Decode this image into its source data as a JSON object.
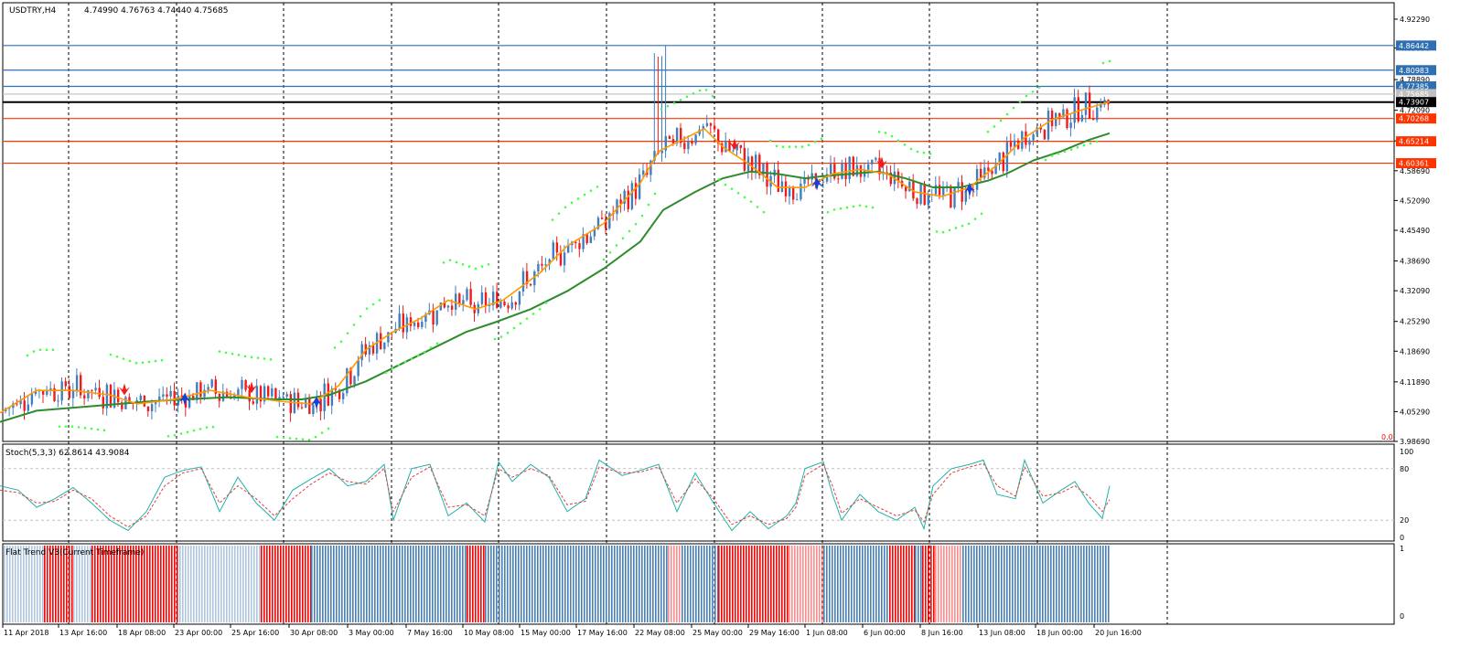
{
  "chart_data": [
    {
      "type": "candlestick",
      "title": "USDTRY,H4",
      "ohlc": [
        "4.74990",
        "4.76763",
        "4.74440",
        "4.75685"
      ],
      "y_range": [
        3.9869,
        4.9532
      ],
      "y_ticks": [
        "4.92290",
        "4.85890",
        "4.78890",
        "4.72090",
        "4.65290",
        "4.58690",
        "4.52090",
        "4.45490",
        "4.38690",
        "4.32090",
        "4.25290",
        "4.18690",
        "4.11890",
        "4.05290",
        "3.98690"
      ],
      "price_levels": [
        {
          "value": 4.86442,
          "label": "4.86442",
          "color": "#2f6fb3"
        },
        {
          "value": 4.80983,
          "label": "4.80983",
          "color": "#2f6fb3"
        },
        {
          "value": 4.77385,
          "label": "4.77385",
          "color": "#2f6fb3"
        },
        {
          "value": 4.75685,
          "label": "4.75685",
          "color": "#c0c0c0"
        },
        {
          "value": 4.73907,
          "label": "4.73907",
          "color": "#000000"
        },
        {
          "value": 4.70268,
          "label": "4.70268",
          "color": "#ff3300"
        },
        {
          "value": 4.65214,
          "label": "4.65214",
          "color": "#ff3300"
        },
        {
          "value": 4.60361,
          "label": "4.60361",
          "color": "#ff3300"
        }
      ],
      "moving_averages": [
        {
          "color": "#2e8b2e",
          "points": [
            [
              0,
              4.03
            ],
            [
              40,
              4.055
            ],
            [
              100,
              4.065
            ],
            [
              160,
              4.075
            ],
            [
              200,
              4.08
            ],
            [
              250,
              4.085
            ],
            [
              300,
              4.08
            ],
            [
              330,
              4.08
            ],
            [
              360,
              4.09
            ],
            [
              400,
              4.12
            ],
            [
              440,
              4.16
            ],
            [
              480,
              4.2
            ],
            [
              510,
              4.23
            ],
            [
              540,
              4.25
            ],
            [
              580,
              4.28
            ],
            [
              620,
              4.32
            ],
            [
              660,
              4.37
            ],
            [
              700,
              4.43
            ],
            [
              725,
              4.5
            ],
            [
              760,
              4.54
            ],
            [
              790,
              4.57
            ],
            [
              820,
              4.585
            ],
            [
              850,
              4.58
            ],
            [
              880,
              4.57
            ],
            [
              900,
              4.575
            ],
            [
              930,
              4.58
            ],
            [
              960,
              4.585
            ],
            [
              990,
              4.57
            ],
            [
              1020,
              4.55
            ],
            [
              1050,
              4.55
            ],
            [
              1080,
              4.565
            ],
            [
              1100,
              4.58
            ],
            [
              1130,
              4.61
            ],
            [
              1160,
              4.63
            ],
            [
              1190,
              4.655
            ],
            [
              1213,
              4.67
            ]
          ]
        },
        {
          "color": "#ff9900",
          "points": [
            [
              0,
              4.05
            ],
            [
              40,
              4.1
            ],
            [
              80,
              4.1
            ],
            [
              120,
              4.09
            ],
            [
              150,
              4.07
            ],
            [
              190,
              4.08
            ],
            [
              230,
              4.1
            ],
            [
              270,
              4.085
            ],
            [
              310,
              4.075
            ],
            [
              340,
              4.07
            ],
            [
              370,
              4.11
            ],
            [
              400,
              4.19
            ],
            [
              430,
              4.23
            ],
            [
              460,
              4.26
            ],
            [
              490,
              4.3
            ],
            [
              520,
              4.28
            ],
            [
              550,
              4.3
            ],
            [
              590,
              4.36
            ],
            [
              620,
              4.42
            ],
            [
              660,
              4.47
            ],
            [
              700,
              4.56
            ],
            [
              720,
              4.63
            ],
            [
              740,
              4.65
            ],
            [
              770,
              4.68
            ],
            [
              790,
              4.64
            ],
            [
              820,
              4.6
            ],
            [
              850,
              4.55
            ],
            [
              880,
              4.55
            ],
            [
              910,
              4.58
            ],
            [
              940,
              4.59
            ],
            [
              970,
              4.58
            ],
            [
              1000,
              4.54
            ],
            [
              1030,
              4.53
            ],
            [
              1060,
              4.55
            ],
            [
              1090,
              4.6
            ],
            [
              1120,
              4.66
            ],
            [
              1150,
              4.7
            ],
            [
              1180,
              4.72
            ],
            [
              1213,
              4.74
            ]
          ]
        }
      ],
      "signals": [
        {
          "dir": "down",
          "x": 136
        },
        {
          "dir": "up",
          "x": 202
        },
        {
          "dir": "down",
          "x": 275
        },
        {
          "dir": "up",
          "x": 346
        },
        {
          "dir": "down",
          "x": 803
        },
        {
          "dir": "up",
          "x": 893
        },
        {
          "dir": "down",
          "x": 964
        },
        {
          "dir": "up",
          "x": 1060
        }
      ],
      "corner_label": "0.0"
    },
    {
      "type": "line",
      "title": "Stoch(5,3,3) 62.8614 43.9084",
      "y_range": [
        0,
        100
      ],
      "y_ticks": [
        "100",
        "80",
        "20",
        "0"
      ],
      "levels": [
        80,
        20
      ],
      "series": [
        {
          "color": "#20b2aa",
          "style": "solid",
          "points": [
            [
              0,
              60
            ],
            [
              20,
              55
            ],
            [
              40,
              35
            ],
            [
              60,
              45
            ],
            [
              80,
              58
            ],
            [
              100,
              40
            ],
            [
              120,
              20
            ],
            [
              140,
              8
            ],
            [
              160,
              30
            ],
            [
              180,
              70
            ],
            [
              200,
              78
            ],
            [
              220,
              82
            ],
            [
              240,
              30
            ],
            [
              260,
              70
            ],
            [
              280,
              40
            ],
            [
              300,
              20
            ],
            [
              320,
              55
            ],
            [
              340,
              68
            ],
            [
              360,
              80
            ],
            [
              380,
              60
            ],
            [
              400,
              65
            ],
            [
              420,
              85
            ],
            [
              430,
              20
            ],
            [
              450,
              80
            ],
            [
              470,
              85
            ],
            [
              490,
              25
            ],
            [
              510,
              40
            ],
            [
              530,
              18
            ],
            [
              545,
              88
            ],
            [
              560,
              65
            ],
            [
              580,
              85
            ],
            [
              600,
              70
            ],
            [
              620,
              30
            ],
            [
              640,
              45
            ],
            [
              655,
              90
            ],
            [
              680,
              72
            ],
            [
              700,
              78
            ],
            [
              720,
              85
            ],
            [
              740,
              30
            ],
            [
              760,
              75
            ],
            [
              780,
              40
            ],
            [
              800,
              8
            ],
            [
              820,
              30
            ],
            [
              840,
              10
            ],
            [
              860,
              25
            ],
            [
              870,
              40
            ],
            [
              880,
              80
            ],
            [
              900,
              88
            ],
            [
              910,
              50
            ],
            [
              920,
              20
            ],
            [
              940,
              50
            ],
            [
              960,
              30
            ],
            [
              980,
              20
            ],
            [
              1000,
              35
            ],
            [
              1010,
              10
            ],
            [
              1020,
              60
            ],
            [
              1040,
              80
            ],
            [
              1060,
              85
            ],
            [
              1075,
              90
            ],
            [
              1090,
              50
            ],
            [
              1110,
              45
            ],
            [
              1120,
              90
            ],
            [
              1140,
              40
            ],
            [
              1160,
              55
            ],
            [
              1175,
              65
            ],
            [
              1190,
              40
            ],
            [
              1205,
              22
            ],
            [
              1213,
              60
            ]
          ]
        },
        {
          "color": "#e04040",
          "style": "dashed",
          "points": [
            [
              0,
              55
            ],
            [
              20,
              52
            ],
            [
              40,
              40
            ],
            [
              60,
              42
            ],
            [
              80,
              55
            ],
            [
              100,
              45
            ],
            [
              120,
              25
            ],
            [
              140,
              12
            ],
            [
              160,
              25
            ],
            [
              180,
              60
            ],
            [
              200,
              75
            ],
            [
              220,
              80
            ],
            [
              240,
              40
            ],
            [
              260,
              60
            ],
            [
              280,
              45
            ],
            [
              300,
              25
            ],
            [
              320,
              45
            ],
            [
              340,
              62
            ],
            [
              360,
              75
            ],
            [
              380,
              65
            ],
            [
              400,
              62
            ],
            [
              420,
              80
            ],
            [
              430,
              30
            ],
            [
              450,
              70
            ],
            [
              470,
              82
            ],
            [
              490,
              35
            ],
            [
              510,
              38
            ],
            [
              530,
              25
            ],
            [
              545,
              80
            ],
            [
              560,
              70
            ],
            [
              580,
              80
            ],
            [
              600,
              72
            ],
            [
              620,
              38
            ],
            [
              640,
              42
            ],
            [
              655,
              82
            ],
            [
              680,
              75
            ],
            [
              700,
              76
            ],
            [
              720,
              82
            ],
            [
              740,
              40
            ],
            [
              760,
              68
            ],
            [
              780,
              45
            ],
            [
              800,
              15
            ],
            [
              820,
              25
            ],
            [
              840,
              15
            ],
            [
              860,
              22
            ],
            [
              870,
              35
            ],
            [
              880,
              72
            ],
            [
              900,
              85
            ],
            [
              910,
              60
            ],
            [
              920,
              28
            ],
            [
              940,
              45
            ],
            [
              960,
              35
            ],
            [
              980,
              25
            ],
            [
              1000,
              32
            ],
            [
              1010,
              18
            ],
            [
              1020,
              50
            ],
            [
              1040,
              75
            ],
            [
              1060,
              82
            ],
            [
              1075,
              86
            ],
            [
              1090,
              60
            ],
            [
              1110,
              48
            ],
            [
              1120,
              82
            ],
            [
              1140,
              48
            ],
            [
              1160,
              52
            ],
            [
              1175,
              60
            ],
            [
              1190,
              48
            ],
            [
              1205,
              30
            ],
            [
              1213,
              44
            ]
          ]
        }
      ]
    },
    {
      "type": "bar",
      "title": "Flat Trend V3(Current Timeframe)",
      "y_ticks": [
        "1",
        "0"
      ],
      "segments": [
        {
          "from": 0,
          "to": 48,
          "color": "#4a7fb5",
          "solid": false
        },
        {
          "from": 48,
          "to": 80,
          "color": "#ff0000",
          "solid": true
        },
        {
          "from": 80,
          "to": 100,
          "color": "#4a7fb5",
          "solid": false
        },
        {
          "from": 100,
          "to": 196,
          "color": "#ff0000",
          "solid": true
        },
        {
          "from": 196,
          "to": 285,
          "color": "#4a7fb5",
          "solid": false
        },
        {
          "from": 285,
          "to": 340,
          "color": "#ff0000",
          "solid": true
        },
        {
          "from": 340,
          "to": 510,
          "color": "#4a7fb5",
          "solid": true
        },
        {
          "from": 510,
          "to": 530,
          "color": "#ff0000",
          "solid": true
        },
        {
          "from": 530,
          "to": 730,
          "color": "#4a7fb5",
          "solid": true
        },
        {
          "from": 730,
          "to": 745,
          "color": "#ff0000",
          "solid": false
        },
        {
          "from": 745,
          "to": 785,
          "color": "#4a7fb5",
          "solid": true
        },
        {
          "from": 785,
          "to": 862,
          "color": "#ff0000",
          "solid": true
        },
        {
          "from": 862,
          "to": 900,
          "color": "#ff0000",
          "solid": false
        },
        {
          "from": 900,
          "to": 972,
          "color": "#4a7fb5",
          "solid": true
        },
        {
          "from": 972,
          "to": 1000,
          "color": "#ff0000",
          "solid": true
        },
        {
          "from": 1000,
          "to": 1008,
          "color": "#4a7fb5",
          "solid": true
        },
        {
          "from": 1008,
          "to": 1022,
          "color": "#ff0000",
          "solid": true
        },
        {
          "from": 1022,
          "to": 1052,
          "color": "#ff0000",
          "solid": false
        },
        {
          "from": 1052,
          "to": 1213,
          "color": "#4a7fb5",
          "solid": true
        }
      ]
    }
  ],
  "x_axis": {
    "labels": [
      "11 Apr 2018",
      "13 Apr 16:00",
      "18 Apr 08:00",
      "23 Apr 00:00",
      "25 Apr 16:00",
      "30 Apr 08:00",
      "3 May 00:00",
      "7 May 16:00",
      "10 May 08:00",
      "15 May 00:00",
      "17 May 16:00",
      "22 May 08:00",
      "25 May 00:00",
      "29 May 16:00",
      "1 Jun 08:00",
      "6 Jun 00:00",
      "8 Jun 16:00",
      "13 Jun 08:00",
      "18 Jun 00:00",
      "20 Jun 16:00"
    ]
  }
}
